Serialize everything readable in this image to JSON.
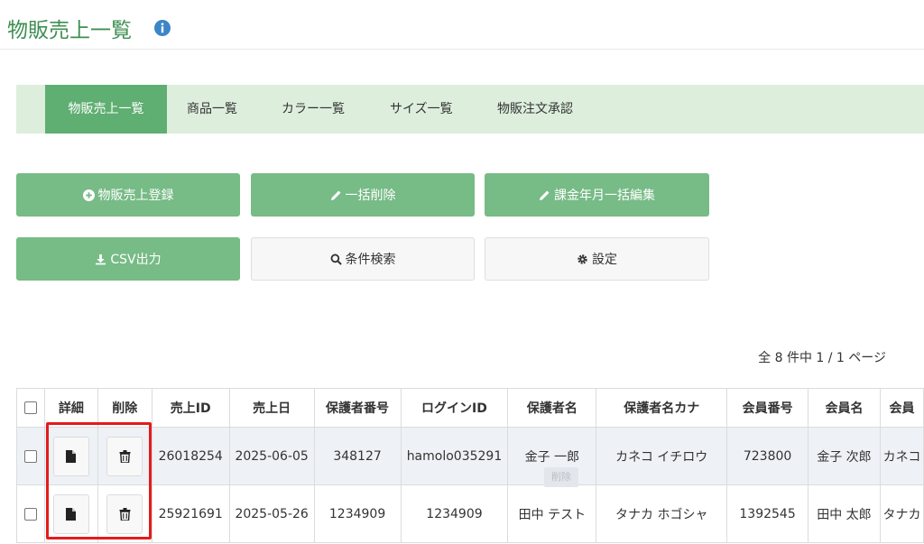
{
  "page": {
    "title": "物販売上一覧"
  },
  "colors": {
    "accent": "#3f8f52",
    "tab_active": "#5fae72",
    "button_green": "#77bb86",
    "highlight": "#e41b1b"
  },
  "tabs": [
    {
      "label": "物販売上一覧",
      "active": true
    },
    {
      "label": "商品一覧"
    },
    {
      "label": "カラー一覧"
    },
    {
      "label": "サイズ一覧"
    },
    {
      "label": "物販注文承認"
    }
  ],
  "actions": {
    "register": {
      "icon": "plus-circle-icon",
      "label": "物販売上登録"
    },
    "bulk_delete": {
      "icon": "pencil-icon",
      "label": "一括削除"
    },
    "bulk_edit_month": {
      "icon": "pencil-icon",
      "label": "課金年月一括編集"
    },
    "csv": {
      "icon": "download-icon",
      "label": "CSV出力"
    },
    "search": {
      "icon": "search-icon",
      "label": "条件検索"
    },
    "settings": {
      "icon": "gear-icon",
      "label": "設定"
    }
  },
  "pagination": {
    "text": "全 8 件中 1 / 1 ページ"
  },
  "table": {
    "headers": [
      "詳細",
      "削除",
      "売上ID",
      "売上日",
      "保護者番号",
      "ログインID",
      "保護者名",
      "保護者名カナ",
      "会員番号",
      "会員名",
      "会員"
    ],
    "rows": [
      [
        "26018254",
        "2025-06-05",
        "348127",
        "hamolo035291",
        "金子 一郎",
        "カネコ イチロウ",
        "723800",
        "金子 次郎",
        "カネコ"
      ],
      [
        "25921691",
        "2025-05-26",
        "1234909",
        "1234909",
        "田中 テスト",
        "タナカ ホゴシャ",
        "1392545",
        "田中 太郎",
        "タナカ"
      ]
    ]
  },
  "tooltip": {
    "text": "削除"
  }
}
